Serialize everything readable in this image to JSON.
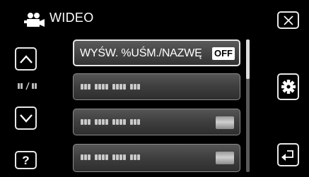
{
  "header": {
    "title": "WIDEO",
    "mode_icon": "video-camera-icon"
  },
  "nav": {
    "close_icon": "close-icon",
    "up_icon": "chevron-up-icon",
    "down_icon": "chevron-down-icon",
    "help_label": "?",
    "gear_icon": "gear-icon",
    "back_icon": "return-icon",
    "page_indicator_icon": "page-indicator-icon"
  },
  "list": {
    "items": [
      {
        "label": "WYŚW. %UŚM./NAZWĘ",
        "value": "OFF",
        "selected": true
      },
      {
        "label": "",
        "value": "",
        "selected": false,
        "icon": "placeholder-text-icon"
      },
      {
        "label": "",
        "value": "",
        "selected": false,
        "icon": "placeholder-text-icon"
      },
      {
        "label": "",
        "value": "",
        "selected": false,
        "icon": "placeholder-text-icon"
      }
    ]
  },
  "scroll": {
    "position_fraction": 0.0,
    "visible_fraction": 0.3
  },
  "colors": {
    "background": "#000000",
    "border": "#e6e6e6",
    "row": "#444444"
  }
}
